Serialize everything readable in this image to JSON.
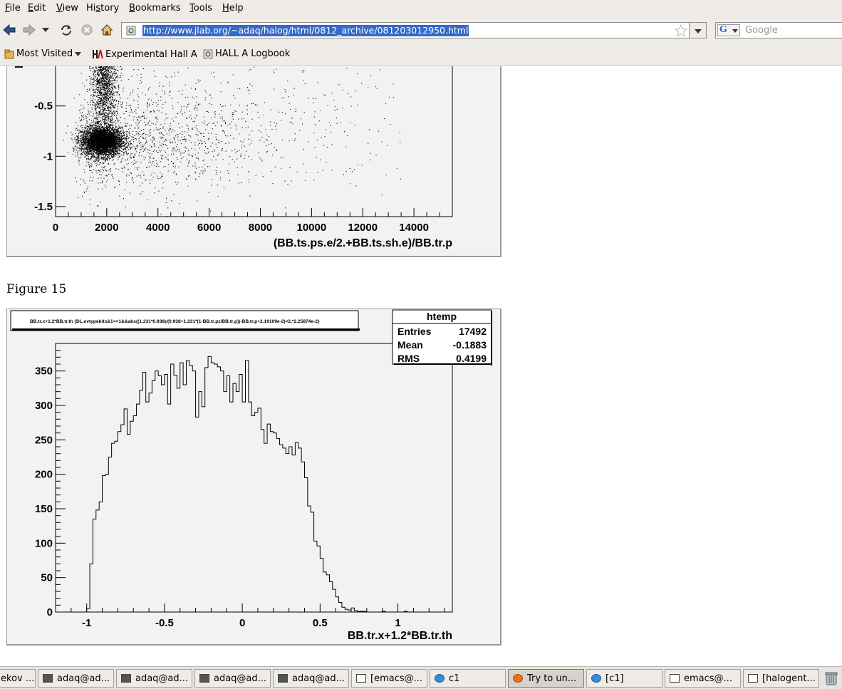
{
  "menu": [
    "File",
    "Edit",
    "View",
    "History",
    "Bookmarks",
    "Tools",
    "Help"
  ],
  "menu_underline": [
    "F",
    "E",
    "V",
    "s",
    "B",
    "T",
    "H"
  ],
  "url": "http://www.jlab.org/~adaq/halog/html/0812_archive/081203012950.html",
  "search_placeholder": "Google",
  "bookmarks": [
    "Most Visited",
    "Experimental Hall A",
    "HALL A Logbook"
  ],
  "figure_caption": "Figure 15",
  "scatter_plot": {
    "x_axis_title": "(BB.ts.ps.e/2.+BB.ts.sh.e)/BB.tr.p",
    "y_axis_cut_label": "E",
    "x_ticks": [
      "0",
      "2000",
      "4000",
      "6000",
      "8000",
      "10000",
      "12000",
      "14000"
    ],
    "y_ticks": [
      "0",
      "-0.5",
      "-1",
      "-1.5"
    ]
  },
  "histogram": {
    "cut_title": "BB.tr.x+1.2*BB.tr.th {DL.evtypebits&1<<1&&abs((1.231*0.938)/(0.938+1.231*(1-BB.tr.pz/BB.tr.p))-BB.tr.p+2.19109e-2)<2.*2.25874e-2}",
    "stats_title": "htemp",
    "stats": [
      {
        "label": "Entries",
        "value": "17492"
      },
      {
        "label": "Mean",
        "value": "-0.1883"
      },
      {
        "label": "RMS",
        "value": "0.4199"
      }
    ],
    "x_axis_title": "BB.tr.x+1.2*BB.tr.th"
  },
  "chart_data": [
    {
      "type": "scatter",
      "title": "",
      "xlabel": "(BB.ts.ps.e/2.+BB.ts.sh.e)/BB.tr.p",
      "ylabel": "",
      "xlim": [
        0,
        15500
      ],
      "ylim": [
        -1.6,
        0.1
      ],
      "x_ticks": [
        0,
        2000,
        4000,
        6000,
        8000,
        10000,
        12000,
        14000
      ],
      "y_ticks": [
        0,
        -0.5,
        -1,
        -1.5
      ],
      "density_clusters": [
        {
          "x_center": 1800,
          "x_spread": 400,
          "y_center": -0.85,
          "y_spread": 0.12
        },
        {
          "x_center": 1900,
          "x_spread": 250,
          "y_center": -0.1,
          "y_spread": 0.25
        }
      ],
      "grid": false
    },
    {
      "type": "bar",
      "title": "BB.tr.x+1.2*BB.tr.th {DL.evtypebits&1<<1&&abs((1.231*0.938)/(0.938+1.231*(1-BB.tr.pz/BB.tr.p))-BB.tr.p+2.19109e-2)<2.*2.25874e-2}",
      "xlabel": "BB.tr.x+1.2*BB.tr.th",
      "ylabel": "",
      "xlim": [
        -1.2,
        1.35
      ],
      "ylim": [
        0,
        390
      ],
      "x_ticks": [
        -1,
        -0.5,
        0,
        0.5,
        1
      ],
      "y_ticks": [
        0,
        50,
        100,
        150,
        200,
        250,
        300,
        350
      ],
      "bin_start": -1.0,
      "bin_width": 0.02,
      "values": [
        5,
        70,
        135,
        148,
        160,
        198,
        200,
        225,
        245,
        248,
        262,
        272,
        295,
        258,
        277,
        285,
        302,
        322,
        348,
        305,
        318,
        336,
        350,
        343,
        330,
        345,
        302,
        360,
        344,
        325,
        362,
        330,
        365,
        358,
        350,
        283,
        320,
        298,
        355,
        371,
        362,
        360,
        356,
        350,
        320,
        343,
        305,
        332,
        320,
        345,
        305,
        365,
        305,
        285,
        290,
        296,
        265,
        245,
        273,
        262,
        260,
        252,
        243,
        238,
        230,
        240,
        228,
        246,
        238,
        218,
        195,
        154,
        145,
        103,
        96,
        78,
        58,
        54,
        44,
        33,
        22,
        14,
        7,
        4,
        3,
        6,
        2,
        1,
        1,
        1,
        0,
        0,
        0,
        0,
        0,
        1,
        0,
        0,
        0,
        0,
        0,
        0,
        1,
        0,
        0
      ],
      "stats": {
        "Entries": 17492,
        "Mean": -0.1883,
        "RMS": 0.4199
      },
      "legend": "top-right stats box"
    }
  ],
  "taskbar": [
    {
      "label": "ekov ...",
      "icon": "window-icon"
    },
    {
      "label": "adaq@ad...",
      "icon": "terminal-icon"
    },
    {
      "label": "adaq@ad...",
      "icon": "terminal-icon"
    },
    {
      "label": "adaq@ad...",
      "icon": "terminal-icon"
    },
    {
      "label": "adaq@ad...",
      "icon": "terminal-icon"
    },
    {
      "label": "[emacs@...",
      "icon": "window-icon"
    },
    {
      "label": "c1",
      "icon": "root-icon"
    },
    {
      "label": "Try to un...",
      "icon": "firefox-icon"
    },
    {
      "label": "[c1]",
      "icon": "root-icon"
    },
    {
      "label": "emacs@...",
      "icon": "window-icon"
    },
    {
      "label": "[halogent...",
      "icon": "window-icon"
    }
  ]
}
